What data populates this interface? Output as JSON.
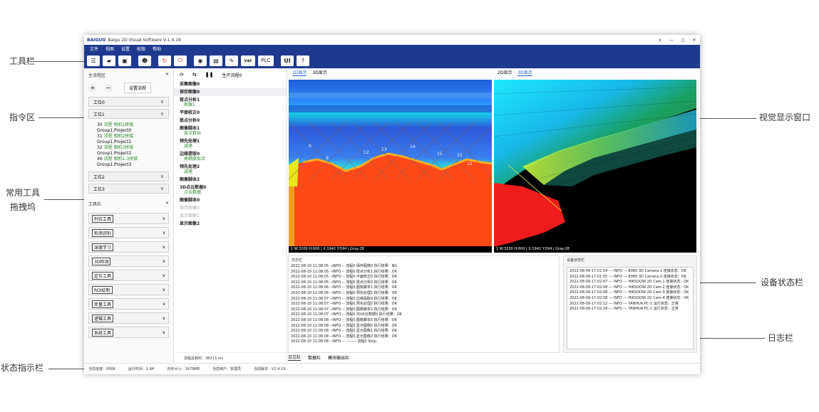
{
  "callouts": {
    "toolbar": "工具栏",
    "command": "指令区",
    "dock_l1": "常用工具",
    "dock_l2": "拖拽坞",
    "status": "状态指示栏",
    "vision": "视觉显示窗口",
    "device": "设备状态栏",
    "log": "日志栏"
  },
  "app": {
    "brand": "BAIGUO",
    "title": "Baigu 2D Visual Software V-1.4.19",
    "controls": [
      "∨",
      "—",
      "◻",
      "✕"
    ]
  },
  "menu": [
    "文件",
    "视图",
    "设置",
    "权限",
    "帮助"
  ],
  "toolbar": {
    "var_label": "var",
    "plc_label": "PLC",
    "ui_label": "UI"
  },
  "process_panel": {
    "title": "主流程区",
    "close": "✕",
    "add": "+",
    "remove": "−",
    "settings_label": "设置流程",
    "stations": [
      "工位0",
      "工位1",
      "工位2",
      "工位3"
    ],
    "station1_items": [
      {
        "no": "30",
        "name": "流程 相机1拼接",
        "proj": "Group1.Project0"
      },
      {
        "no": "31",
        "name": "流程 相机2拼接",
        "proj": "Group1.Project1"
      },
      {
        "no": "32",
        "name": "流程 相机3拼接",
        "proj": "Group1.Project2"
      },
      {
        "no": "46",
        "name": "流程 相机1-3拼接",
        "proj": "Group1.Project3"
      }
    ]
  },
  "tool_panel": {
    "title": "工具栏",
    "tools": [
      "判位工具",
      "检测识别",
      "深度学习",
      "3D检测",
      "定位工具",
      "ROI绘制",
      "变量工具",
      "逻辑工具",
      "系统工具"
    ]
  },
  "flow": {
    "produce_label": "生产流程0",
    "steps": [
      {
        "n": "采集图像0",
        "s": "",
        "gray": false
      },
      {
        "n": "保存图像0",
        "s": "",
        "gray": false
      },
      {
        "n": "斑点分析1",
        "s": "图像1",
        "gray": false
      },
      {
        "n": "平面校正0",
        "s": "",
        "gray": false
      },
      {
        "n": "斑点分析0",
        "s": "",
        "gray": false
      },
      {
        "n": "图像脚本1",
        "s": "斑点目标",
        "gray": false
      },
      {
        "n": "预先处理1",
        "s": "减速",
        "gray": false
      },
      {
        "n": "边缘提取0",
        "s": "高精度拟合",
        "gray": false
      },
      {
        "n": "预先处理2",
        "s": "减速",
        "gray": false
      },
      {
        "n": "图像脚本2",
        "s": "",
        "gray": false
      },
      {
        "n": "3D点云数据0",
        "s": "点云数据",
        "gray": false
      },
      {
        "n": "图像脚本0",
        "s": "",
        "gray": false
      },
      {
        "n": "显示图像0",
        "s": "",
        "gray": true
      },
      {
        "n": "显示图像1",
        "s": "",
        "gray": true
      },
      {
        "n": "显示图像2",
        "s": "",
        "gray": false
      }
    ],
    "total_time": "流程总耗时：38213 ms"
  },
  "viewers": {
    "left_tabs": [
      "2D显示",
      "3D显示"
    ],
    "right_tabs": [
      "2D显示",
      "3D显示"
    ],
    "left_status": "1  W:3200 H:600 | X:1942 Y:594 | Gray:28",
    "right_status": "1  W:3200 H:600 | X:1942 Y:594 | Gray:28"
  },
  "log": {
    "title": "日志栏",
    "lines": [
      "2022-08-10 11:08:05 --INFO -- 流程0.保存图像0 执行结果：NG",
      "2022-08-10 11:08:05 --INFO -- 流程0.斑点分析1 执行结果：OK",
      "2022-08-10 11:08:05 --INFO -- 流程0.平面校正0 执行结果：OK",
      "2022-08-10 11:08:05 --INFO -- 流程0.斑点分析0 执行结果：OK",
      "2022-08-10 11:08:06 --INFO -- 流程0.图像脚本1 执行结果：OK",
      "2022-08-10 11:08:06 --INFO -- 流程0.预先处理1 执行结果：OK",
      "2022-08-10 11:08:07 --INFO -- 流程0.边缘提取0 执行结果：OK",
      "2022-08-10 11:08:07 --INFO -- 流程0.预先处理2 执行结果：OK",
      "2022-08-10 11:08:07 --INFO -- 流程0.图像脚本2 执行结果：OK",
      "2022-08-10 11:08:07 --INFO -- 流程0.3D点云数据0 执行结果：OK",
      "2022-08-10 11:08:08 --INFO -- 流程0.图像脚本0 执行结果：OK",
      "2022-08-10 11:08:08 --INFO -- 流程0.显示图像0 执行结果：OK",
      "2022-08-10 11:08:08 --INFO -- 流程0.显示图像1 执行结果：OK",
      "2022-08-10 11:08:08 --INFO -- 流程0.显示图像2 执行结果：OK",
      "2022-08-10 11:08:08 --INFO -- ---------流程0 Stop。"
    ],
    "tabs": [
      "日志栏",
      "数据栏",
      "模块输出栏"
    ]
  },
  "device": {
    "title": "设备状态栏",
    "lines": [
      "2022-08-09-17:01:54 --- INFO --- 8080 3D Camera-1 连接状态：OK",
      "2022-08-09-17:01:55 --- INFO --- 8080 3D Camera-2 连接状态：OK",
      "2022-08-09-17:02:07 --- INFO --- HIKSOOW 2D Cam-1 连接状态：OK",
      "2022-08-09-17:02:08 --- INFO --- HIKSOOW 2D Cam-2 连接状态：OK",
      "2022-08-09-17:02:08 --- INFO --- HIKSOOW 2D Cam-3 连接状态：OK",
      "2022-08-09-17:02:08 --- INFO --- HIKSOOW 2D Cam-4 连接状态：OK",
      "2022-08-09-17:02:12 --- INFO --- YANHUA PC-1 运行状态：正常",
      "2022-08-09-17:02:18 --- INFO --- YANHUA PC-1 运行状态：正常"
    ]
  },
  "statusbar": [
    "当前进度：0666",
    "运行时间：1.9H",
    "内存大小：1679MB",
    "当前用户：管理员",
    "当前版本：V1.4.19"
  ],
  "heat_labels": [
    "6",
    "9",
    "12",
    "13",
    "14",
    "15",
    "15",
    "12"
  ]
}
